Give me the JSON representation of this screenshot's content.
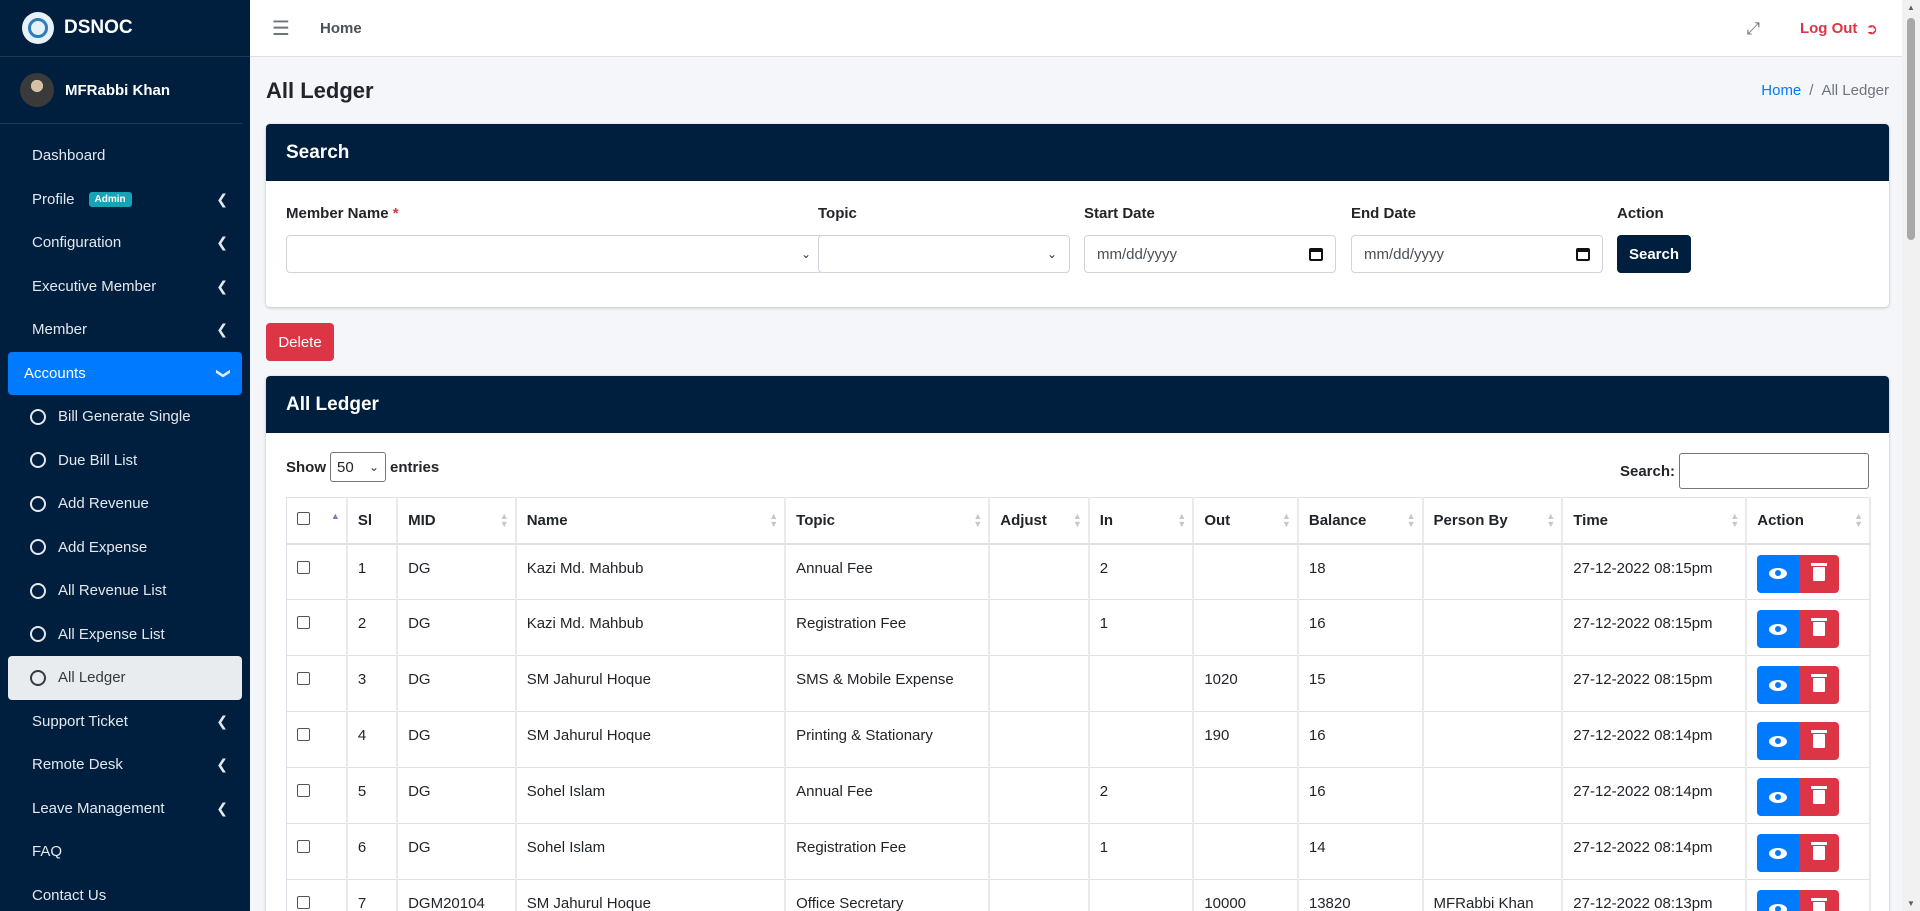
{
  "brand": {
    "name": "DSNOC"
  },
  "user": {
    "name": "MFRabbi Khan"
  },
  "sidebar": {
    "items": [
      {
        "label": "Dashboard"
      },
      {
        "label": "Profile",
        "badge": "Admin"
      },
      {
        "label": "Configuration"
      },
      {
        "label": "Executive Member"
      },
      {
        "label": "Member"
      },
      {
        "label": "Accounts"
      },
      {
        "label": "Bill Generate Single"
      },
      {
        "label": "Due Bill List"
      },
      {
        "label": "Add Revenue"
      },
      {
        "label": "Add Expense"
      },
      {
        "label": "All Revenue List"
      },
      {
        "label": "All Expense List"
      },
      {
        "label": "All Ledger"
      },
      {
        "label": "Support Ticket"
      },
      {
        "label": "Remote Desk"
      },
      {
        "label": "Leave Management"
      },
      {
        "label": "FAQ"
      },
      {
        "label": "Contact Us"
      }
    ]
  },
  "topbar": {
    "home": "Home",
    "logout": "Log Out"
  },
  "page": {
    "title": "All Ledger",
    "breadcrumb_home": "Home",
    "breadcrumb_sep": "/",
    "breadcrumb_current": "All Ledger"
  },
  "search": {
    "header": "Search",
    "member_label": "Member Name",
    "required_mark": "*",
    "topic_label": "Topic",
    "start_label": "Start Date",
    "start_placeholder": "mm/dd/yyyy",
    "end_label": "End Date",
    "end_placeholder": "mm/dd/yyyy",
    "action_label": "Action",
    "search_button": "Search"
  },
  "delete_button": "Delete",
  "ledger": {
    "header": "All Ledger",
    "show": "Show",
    "entries_value": "50",
    "entries": "entries",
    "search_label": "Search:",
    "columns": [
      "Sl",
      "MID",
      "Name",
      "Topic",
      "Adjust",
      "In",
      "Out",
      "Balance",
      "Person By",
      "Time",
      "Action"
    ],
    "rows": [
      {
        "sl": "1",
        "mid": "DG",
        "name": "Kazi Md. Mahbub",
        "topic": "Annual Fee",
        "adjust": "",
        "in": "2",
        "out": "",
        "balance": "18",
        "person": "",
        "time": "27-12-2022 08:15pm"
      },
      {
        "sl": "2",
        "mid": "DG",
        "name": "Kazi Md. Mahbub",
        "topic": "Registration Fee",
        "adjust": "",
        "in": "1",
        "out": "",
        "balance": "16",
        "person": "",
        "time": "27-12-2022 08:15pm"
      },
      {
        "sl": "3",
        "mid": "DG",
        "name": "SM Jahurul Hoque",
        "topic": "SMS & Mobile Expense",
        "adjust": "",
        "in": "",
        "out": "1020",
        "balance": "15",
        "person": "",
        "time": "27-12-2022 08:15pm"
      },
      {
        "sl": "4",
        "mid": "DG",
        "name": "SM Jahurul Hoque",
        "topic": "Printing & Stationary",
        "adjust": "",
        "in": "",
        "out": "190",
        "balance": "16",
        "person": "",
        "time": "27-12-2022 08:14pm"
      },
      {
        "sl": "5",
        "mid": "DG",
        "name": "Sohel Islam",
        "topic": "Annual Fee",
        "adjust": "",
        "in": "2",
        "out": "",
        "balance": "16",
        "person": "",
        "time": "27-12-2022 08:14pm"
      },
      {
        "sl": "6",
        "mid": "DG",
        "name": "Sohel Islam",
        "topic": "Registration Fee",
        "adjust": "",
        "in": "1",
        "out": "",
        "balance": "14",
        "person": "",
        "time": "27-12-2022 08:14pm"
      },
      {
        "sl": "7",
        "mid": "DGM20104",
        "name": "SM Jahurul Hoque",
        "topic": "Office Secretary",
        "adjust": "",
        "in": "",
        "out": "10000",
        "balance": "13820",
        "person": "MFRabbi Khan",
        "time": "27-12-2022 08:13pm"
      }
    ]
  }
}
